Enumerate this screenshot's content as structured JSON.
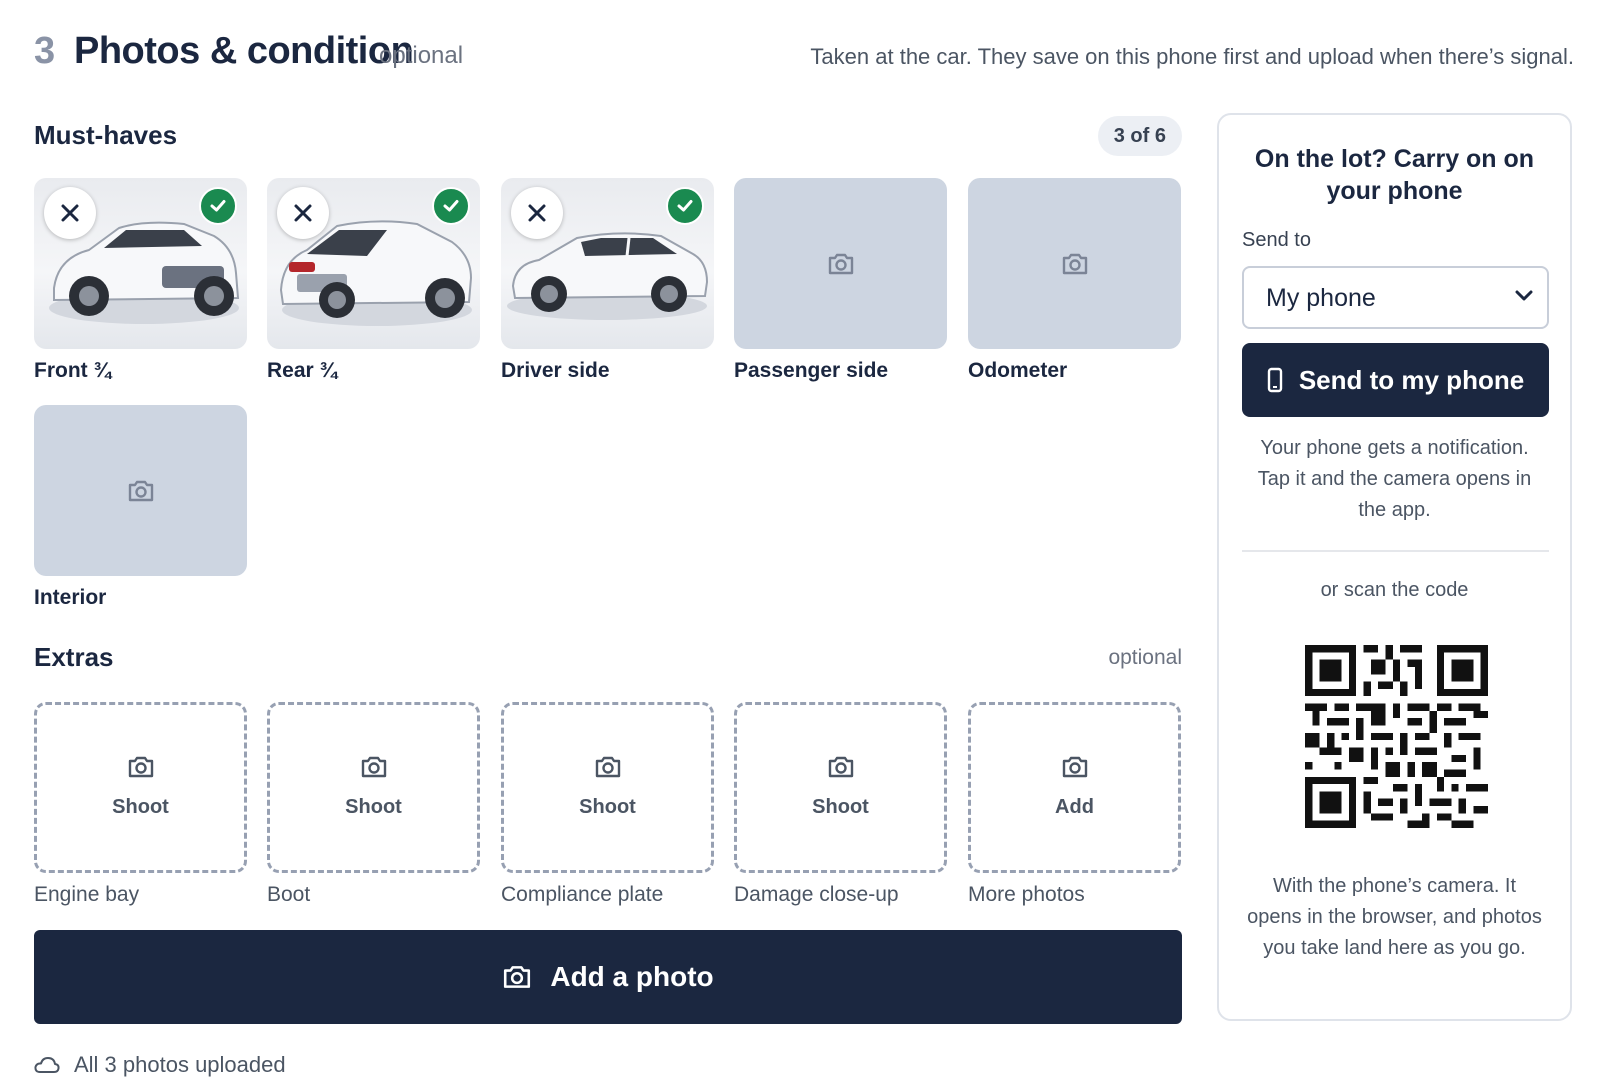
{
  "header": {
    "step_number": "3",
    "title": "Photos & condition",
    "optional": "optional",
    "description": "Taken at the car. They save on this phone first and upload when there’s signal."
  },
  "must_haves": {
    "title": "Must-haves",
    "count": "3 of 6",
    "tiles": [
      {
        "label": "Front ¾",
        "state": "captured"
      },
      {
        "label": "Rear ¾",
        "state": "captured"
      },
      {
        "label": "Driver side",
        "state": "captured"
      },
      {
        "label": "Passenger side",
        "state": "empty"
      },
      {
        "label": "Odometer",
        "state": "empty"
      },
      {
        "label": "Interior",
        "state": "empty"
      }
    ]
  },
  "extras": {
    "title": "Extras",
    "optional": "optional",
    "tiles": [
      {
        "label": "Engine bay",
        "action": "Shoot"
      },
      {
        "label": "Boot",
        "action": "Shoot"
      },
      {
        "label": "Compliance plate",
        "action": "Shoot"
      },
      {
        "label": "Damage close-up",
        "action": "Shoot"
      },
      {
        "label": "More photos",
        "action": "Add"
      }
    ]
  },
  "add_photo_button": "Add a photo",
  "upload_status": "All 3 photos uploaded",
  "side_panel": {
    "title": "On the lot? Carry on on your phone",
    "send_to_label": "Send to",
    "send_to_value": "My phone",
    "send_button": "Send to my phone",
    "help_text": "Your phone gets a notification. Tap it and the camera opens in the app.",
    "scan_label": "or scan the code",
    "scan_help": "With the phone’s camera. It opens in the browser, and photos you take land here as you go."
  },
  "colors": {
    "navy": "#1b2740",
    "success": "#1a8a50",
    "placeholder": "#cdd5e1"
  },
  "icons": [
    "camera-icon",
    "close-icon",
    "check-icon",
    "phone-icon",
    "chevron-down-icon",
    "cloud-icon",
    "qr-code"
  ]
}
